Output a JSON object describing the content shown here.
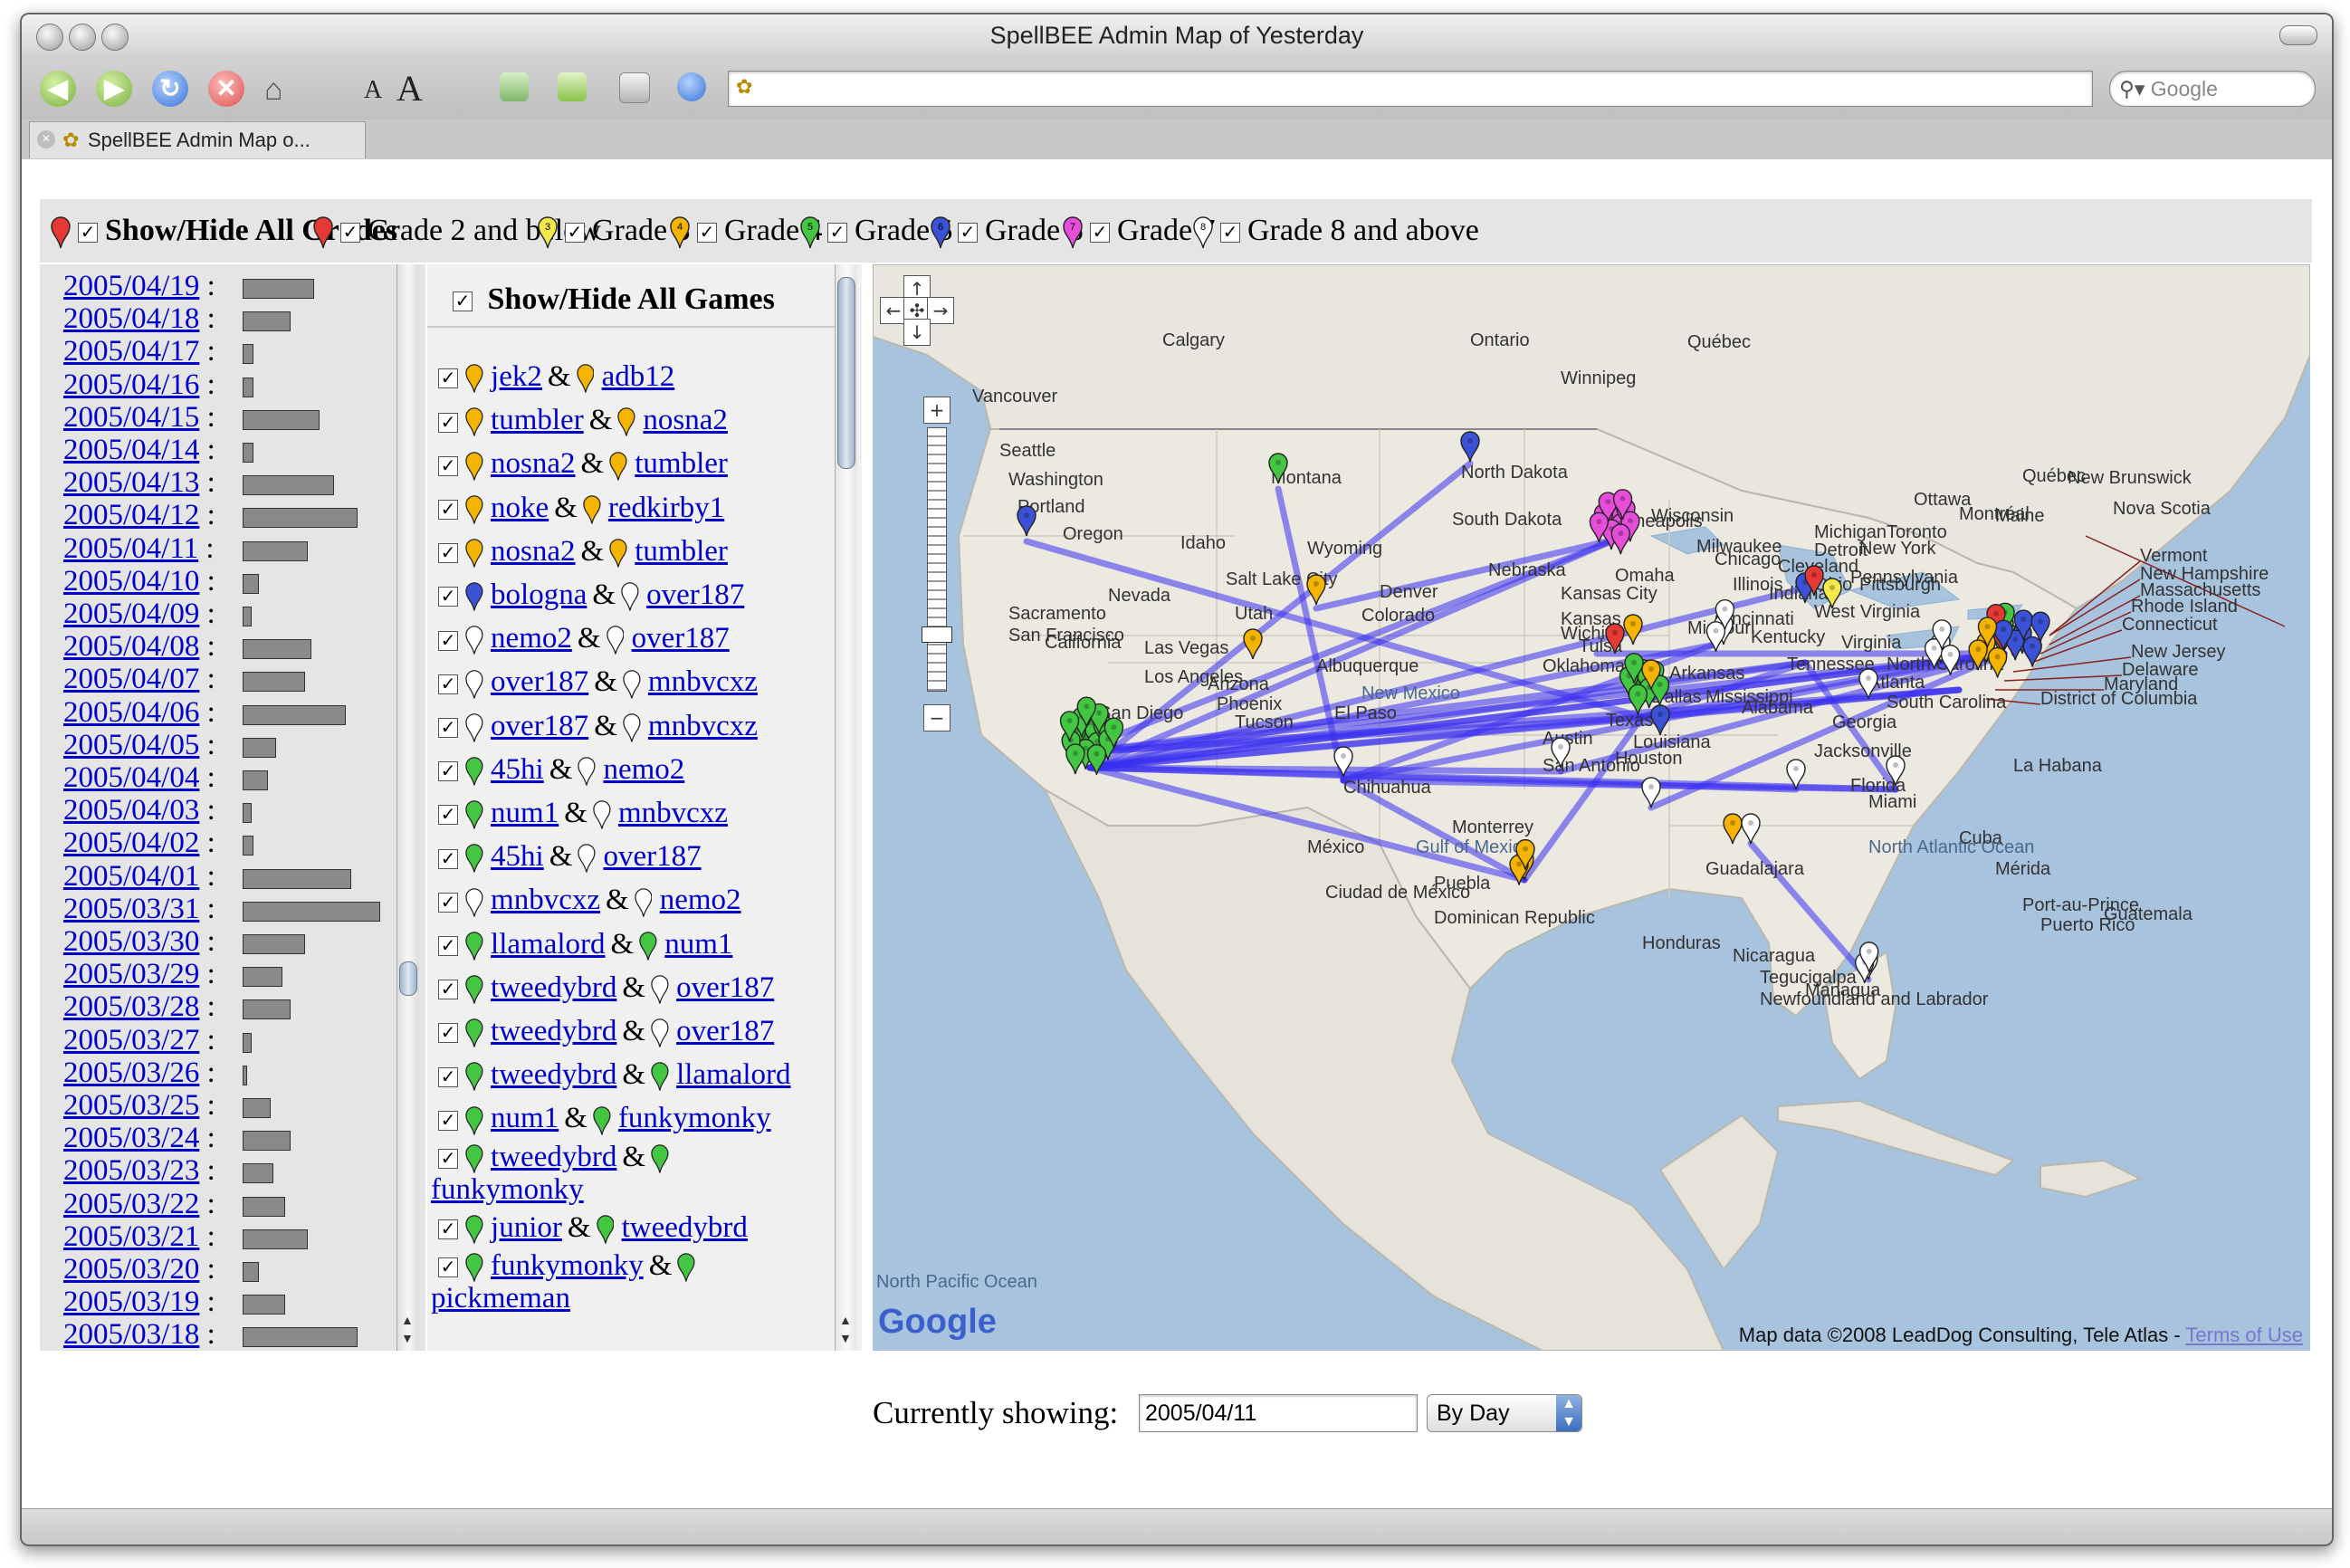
{
  "window": {
    "title": "SpellBEE Admin Map of Yesterday"
  },
  "toolbar": {
    "search_placeholder": "Google",
    "font_small": "A",
    "font_large": "A",
    "address": ""
  },
  "tab": {
    "label": "SpellBEE Admin Map o..."
  },
  "grades": [
    {
      "label": "Show/Hide All Grades",
      "color": "#e53935",
      "pin_text": "",
      "bold": true
    },
    {
      "label": "Grade 2 and below",
      "color": "#e53935",
      "pin_text": "",
      "bold": false
    },
    {
      "label": "Grade 3",
      "color": "#f5e84a",
      "pin_text": "3",
      "bold": false
    },
    {
      "label": "Grade 4",
      "color": "#f5b400",
      "pin_text": "4",
      "bold": false
    },
    {
      "label": "Grade 5",
      "color": "#43c743",
      "pin_text": "5",
      "bold": false
    },
    {
      "label": "Grade 6",
      "color": "#3c52d6",
      "pin_text": "6",
      "bold": false
    },
    {
      "label": "Grade 7",
      "color": "#e64ed9",
      "pin_text": "7",
      "bold": false
    },
    {
      "label": "Grade 8 and above",
      "color": "#ffffff",
      "pin_text": "8",
      "bold": false
    }
  ],
  "dates": [
    {
      "date": "2005/04/19",
      "value": 48
    },
    {
      "date": "2005/04/18",
      "value": 32
    },
    {
      "date": "2005/04/17",
      "value": 6
    },
    {
      "date": "2005/04/16",
      "value": 6
    },
    {
      "date": "2005/04/15",
      "value": 52
    },
    {
      "date": "2005/04/14",
      "value": 6
    },
    {
      "date": "2005/04/13",
      "value": 62
    },
    {
      "date": "2005/04/12",
      "value": 78
    },
    {
      "date": "2005/04/11",
      "value": 44
    },
    {
      "date": "2005/04/10",
      "value": 10
    },
    {
      "date": "2005/04/09",
      "value": 5
    },
    {
      "date": "2005/04/08",
      "value": 46
    },
    {
      "date": "2005/04/07",
      "value": 42
    },
    {
      "date": "2005/04/06",
      "value": 70
    },
    {
      "date": "2005/04/05",
      "value": 22
    },
    {
      "date": "2005/04/04",
      "value": 16
    },
    {
      "date": "2005/04/03",
      "value": 5
    },
    {
      "date": "2005/04/02",
      "value": 6
    },
    {
      "date": "2005/04/01",
      "value": 74
    },
    {
      "date": "2005/03/31",
      "value": 94
    },
    {
      "date": "2005/03/30",
      "value": 42
    },
    {
      "date": "2005/03/29",
      "value": 26
    },
    {
      "date": "2005/03/28",
      "value": 32
    },
    {
      "date": "2005/03/27",
      "value": 5
    },
    {
      "date": "2005/03/26",
      "value": 2
    },
    {
      "date": "2005/03/25",
      "value": 18
    },
    {
      "date": "2005/03/24",
      "value": 32
    },
    {
      "date": "2005/03/23",
      "value": 20
    },
    {
      "date": "2005/03/22",
      "value": 28
    },
    {
      "date": "2005/03/21",
      "value": 44
    },
    {
      "date": "2005/03/20",
      "value": 10
    },
    {
      "date": "2005/03/19",
      "value": 28
    },
    {
      "date": "2005/03/18",
      "value": 78
    }
  ],
  "games_header": "Show/Hide All Games",
  "games": [
    {
      "p1": "jek2",
      "c1": "#f5b400",
      "p2": "adb12",
      "c2": "#f5b400",
      "wrap": false
    },
    {
      "p1": "tumbler",
      "c1": "#f5b400",
      "p2": "nosna2",
      "c2": "#f5b400",
      "wrap": false
    },
    {
      "p1": "nosna2",
      "c1": "#f5b400",
      "p2": "tumbler",
      "c2": "#f5b400",
      "wrap": false
    },
    {
      "p1": "noke",
      "c1": "#f5b400",
      "p2": "redkirby1",
      "c2": "#f5b400",
      "wrap": false
    },
    {
      "p1": "nosna2",
      "c1": "#f5b400",
      "p2": "tumbler",
      "c2": "#f5b400",
      "wrap": false
    },
    {
      "p1": "bologna",
      "c1": "#3c52d6",
      "p2": "over187",
      "c2": "#ffffff",
      "wrap": false
    },
    {
      "p1": "nemo2",
      "c1": "#ffffff",
      "p2": "over187",
      "c2": "#ffffff",
      "wrap": false
    },
    {
      "p1": "over187",
      "c1": "#ffffff",
      "p2": "mnbvcxz",
      "c2": "#ffffff",
      "wrap": false
    },
    {
      "p1": "over187",
      "c1": "#ffffff",
      "p2": "mnbvcxz",
      "c2": "#ffffff",
      "wrap": false
    },
    {
      "p1": "45hi",
      "c1": "#43c743",
      "p2": "nemo2",
      "c2": "#ffffff",
      "wrap": false
    },
    {
      "p1": "num1",
      "c1": "#43c743",
      "p2": "mnbvcxz",
      "c2": "#ffffff",
      "wrap": false
    },
    {
      "p1": "45hi",
      "c1": "#43c743",
      "p2": "over187",
      "c2": "#ffffff",
      "wrap": false
    },
    {
      "p1": "mnbvcxz",
      "c1": "#ffffff",
      "p2": "nemo2",
      "c2": "#ffffff",
      "wrap": false
    },
    {
      "p1": "llamalord",
      "c1": "#43c743",
      "p2": "num1",
      "c2": "#43c743",
      "wrap": false
    },
    {
      "p1": "tweedybrd",
      "c1": "#43c743",
      "p2": "over187",
      "c2": "#ffffff",
      "wrap": false
    },
    {
      "p1": "tweedybrd",
      "c1": "#43c743",
      "p2": "over187",
      "c2": "#ffffff",
      "wrap": false
    },
    {
      "p1": "tweedybrd",
      "c1": "#43c743",
      "p2": "llamalord",
      "c2": "#43c743",
      "wrap": false
    },
    {
      "p1": "num1",
      "c1": "#43c743",
      "p2": "funkymonky",
      "c2": "#43c743",
      "wrap": false
    },
    {
      "p1": "tweedybrd",
      "c1": "#43c743",
      "p2": "funkymonky",
      "c2": "#43c743",
      "wrap": true
    },
    {
      "p1": "junior",
      "c1": "#43c743",
      "p2": "tweedybrd",
      "c2": "#43c743",
      "wrap": false
    },
    {
      "p1": "funkymonky",
      "c1": "#43c743",
      "p2": "pickmeman",
      "c2": "#43c743",
      "wrap": true
    }
  ],
  "map": {
    "attribution": "Map data ©2008 LeadDog Consulting, Tele Atlas -",
    "terms": "Terms of Use",
    "logo": "Google",
    "pacific": "North Pacific Ocean",
    "labels": [
      {
        "t": "Calgary"
      },
      {
        "t": "Ontario"
      },
      {
        "t": "Québec"
      },
      {
        "t": "Winnipeg"
      },
      {
        "t": "Vancouver"
      },
      {
        "t": "Seattle"
      },
      {
        "t": "Washington"
      },
      {
        "t": "Montana"
      },
      {
        "t": "North Dakota"
      },
      {
        "t": "Portland"
      },
      {
        "t": "Oregon"
      },
      {
        "t": "Idaho"
      },
      {
        "t": "Wyoming"
      },
      {
        "t": "South Dakota"
      },
      {
        "t": "Minneapolis"
      },
      {
        "t": "Wisconsin"
      },
      {
        "t": "Michigan"
      },
      {
        "t": "Toronto"
      },
      {
        "t": "Ottawa"
      },
      {
        "t": "Montréal"
      },
      {
        "t": "Québec"
      },
      {
        "t": "Maine"
      },
      {
        "t": "New Brunswick"
      },
      {
        "t": "Nova Scotia"
      },
      {
        "t": "Vermont"
      },
      {
        "t": "New Hampshire"
      },
      {
        "t": "Massachusetts"
      },
      {
        "t": "Rhode Island"
      },
      {
        "t": "Connecticut"
      },
      {
        "t": "New Jersey"
      },
      {
        "t": "Delaware"
      },
      {
        "t": "Maryland"
      },
      {
        "t": "District of Columbia"
      },
      {
        "t": "Nebraska"
      },
      {
        "t": "Omaha"
      },
      {
        "t": "Chicago"
      },
      {
        "t": "Milwaukee"
      },
      {
        "t": "Detroit"
      },
      {
        "t": "Cleveland"
      },
      {
        "t": "Ohio"
      },
      {
        "t": "Illinois"
      },
      {
        "t": "Indiana"
      },
      {
        "t": "Pittsburgh"
      },
      {
        "t": "New York"
      },
      {
        "t": "Pennsylvania"
      },
      {
        "t": "Nevada"
      },
      {
        "t": "Salt Lake City"
      },
      {
        "t": "Utah"
      },
      {
        "t": "Denver"
      },
      {
        "t": "Colorado"
      },
      {
        "t": "Kansas City"
      },
      {
        "t": "Kansas"
      },
      {
        "t": "Wichita"
      },
      {
        "t": "Missouri"
      },
      {
        "t": "Cincinnati"
      },
      {
        "t": "West Virginia"
      },
      {
        "t": "Virginia"
      },
      {
        "t": "Kentucky"
      },
      {
        "t": "Sacramento"
      },
      {
        "t": "San Francisco"
      },
      {
        "t": "California"
      },
      {
        "t": "Las Vegas"
      },
      {
        "t": "Los Angeles"
      },
      {
        "t": "San Diego"
      },
      {
        "t": "Arizona"
      },
      {
        "t": "Phoenix"
      },
      {
        "t": "Tucson"
      },
      {
        "t": "Albuquerque"
      },
      {
        "t": "New Mexico"
      },
      {
        "t": "El Paso"
      },
      {
        "t": "Tulsa"
      },
      {
        "t": "Oklahoma"
      },
      {
        "t": "Arkansas"
      },
      {
        "t": "Tennessee"
      },
      {
        "t": "North Carolina"
      },
      {
        "t": "Atlanta"
      },
      {
        "t": "South Carolina"
      },
      {
        "t": "Dallas"
      },
      {
        "t": "Texas"
      },
      {
        "t": "Mississippi"
      },
      {
        "t": "Alabama"
      },
      {
        "t": "Georgia"
      },
      {
        "t": "Austin"
      },
      {
        "t": "Houston"
      },
      {
        "t": "San Antonio"
      },
      {
        "t": "Louisiana"
      },
      {
        "t": "Jacksonville"
      },
      {
        "t": "Florida"
      },
      {
        "t": "Miami"
      },
      {
        "t": "Chihuahua"
      },
      {
        "t": "Monterrey"
      },
      {
        "t": "México"
      },
      {
        "t": "Gulf of Mexico"
      },
      {
        "t": "North Atlantic Ocean"
      },
      {
        "t": "La Habana"
      },
      {
        "t": "Cuba"
      },
      {
        "t": "Mérida"
      },
      {
        "t": "Guadalajara"
      },
      {
        "t": "Ciudad de México"
      },
      {
        "t": "Puebla"
      },
      {
        "t": "Dominican Republic"
      },
      {
        "t": "Port-au-Prince"
      },
      {
        "t": "Puerto Rico"
      },
      {
        "t": "Guatemala"
      },
      {
        "t": "Honduras"
      },
      {
        "t": "Nicaragua"
      },
      {
        "t": "Tegucigalpa"
      },
      {
        "t": "Managua"
      },
      {
        "t": "Newfoundland and Labrador"
      }
    ]
  },
  "bottom": {
    "label": "Currently showing:",
    "date": "2005/04/11",
    "mode": "By Day"
  }
}
